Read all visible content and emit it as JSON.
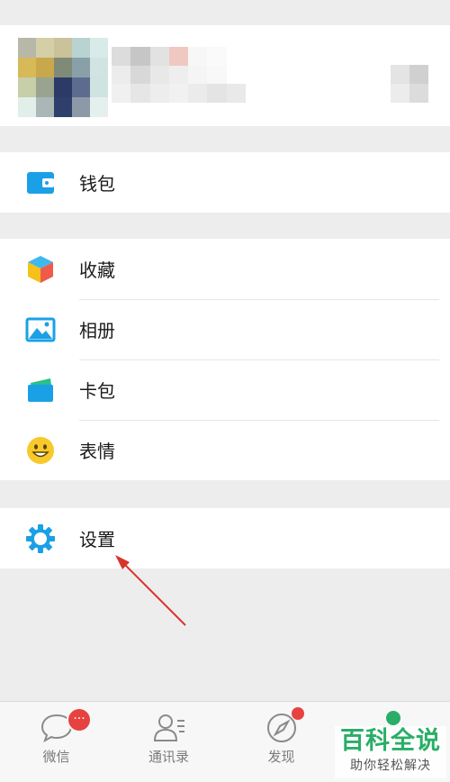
{
  "menu": {
    "wallet": "钱包",
    "favorites": "收藏",
    "album": "相册",
    "cards": "卡包",
    "stickers": "表情",
    "settings": "设置"
  },
  "tabbar": {
    "chats": "微信",
    "chats_badge": "···",
    "contacts": "通讯录",
    "discover": "发现"
  },
  "watermark": {
    "title": "百科全说",
    "subtitle": "助你轻松解决"
  },
  "colors": {
    "accent_green": "#2aae67",
    "badge_red": "#e64340",
    "icon_blue": "#1aa0e6",
    "annotation_arrow": "#d9342b"
  },
  "icons": {
    "wallet": "wallet-icon",
    "favorites": "cube-icon",
    "album": "picture-icon",
    "cards": "card-icon",
    "stickers": "smiley-icon",
    "settings": "gear-icon",
    "chats": "chat-bubble-icon",
    "contacts": "contacts-icon",
    "discover": "compass-icon"
  }
}
